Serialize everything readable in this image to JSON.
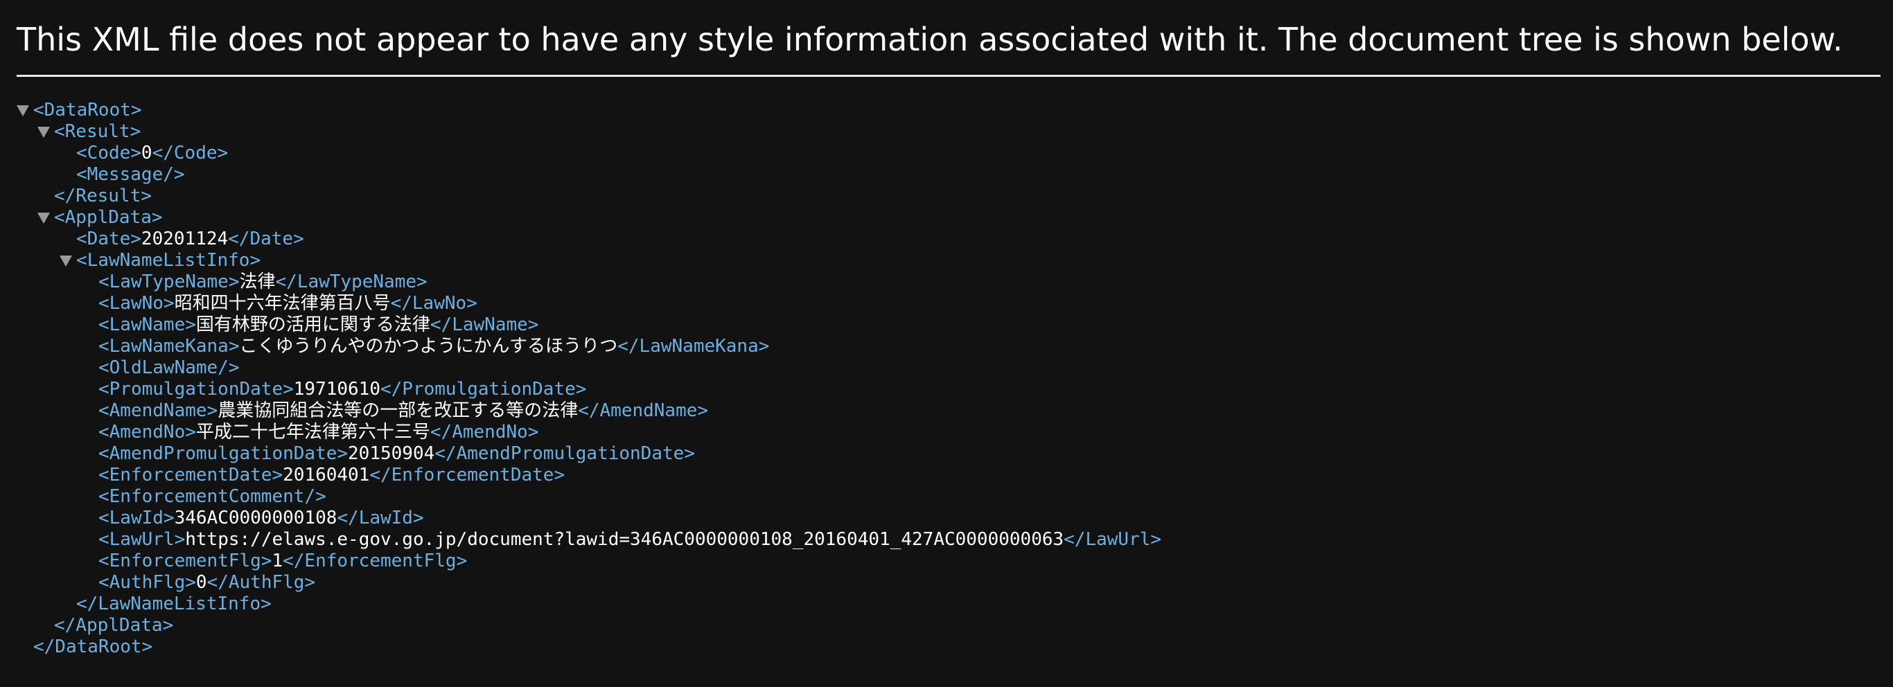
{
  "notice": "This XML file does not appear to have any style information associated with it. The document tree is shown below.",
  "tree": {
    "dataroot_open": "<DataRoot>",
    "result_open": "<Result>",
    "code_open": "<Code>",
    "code_value": "0",
    "code_close": "</Code>",
    "message_empty": "<Message/>",
    "result_close": "</Result>",
    "appldata_open": "<ApplData>",
    "date_open": "<Date>",
    "date_value": "20201124",
    "date_close": "</Date>",
    "lawnamelistinfo_open": "<LawNameListInfo>",
    "lawtypename_open": "<LawTypeName>",
    "lawtypename_value": "法律",
    "lawtypename_close": "</LawTypeName>",
    "lawno_open": "<LawNo>",
    "lawno_value": "昭和四十六年法律第百八号",
    "lawno_close": "</LawNo>",
    "lawname_open": "<LawName>",
    "lawname_value": "国有林野の活用に関する法律",
    "lawname_close": "</LawName>",
    "lawnamekana_open": "<LawNameKana>",
    "lawnamekana_value": "こくゆうりんやのかつようにかんするほうりつ",
    "lawnamekana_close": "</LawNameKana>",
    "oldlawname_empty": "<OldLawName/>",
    "promulgationdate_open": "<PromulgationDate>",
    "promulgationdate_value": "19710610",
    "promulgationdate_close": "</PromulgationDate>",
    "amendname_open": "<AmendName>",
    "amendname_value": "農業協同組合法等の一部を改正する等の法律",
    "amendname_close": "</AmendName>",
    "amendno_open": "<AmendNo>",
    "amendno_value": "平成二十七年法律第六十三号",
    "amendno_close": "</AmendNo>",
    "amendpromulgationdate_open": "<AmendPromulgationDate>",
    "amendpromulgationdate_value": "20150904",
    "amendpromulgationdate_close": "</AmendPromulgationDate>",
    "enforcementdate_open": "<EnforcementDate>",
    "enforcementdate_value": "20160401",
    "enforcementdate_close": "</EnforcementDate>",
    "enforcementcomment_empty": "<EnforcementComment/>",
    "lawid_open": "<LawId>",
    "lawid_value": "346AC0000000108",
    "lawid_close": "</LawId>",
    "lawurl_open": "<LawUrl>",
    "lawurl_value": "https://elaws.e-gov.go.jp/document?lawid=346AC0000000108_20160401_427AC0000000063",
    "lawurl_close": "</LawUrl>",
    "enforcementflg_open": "<EnforcementFlg>",
    "enforcementflg_value": "1",
    "enforcementflg_close": "</EnforcementFlg>",
    "authflg_open": "<AuthFlg>",
    "authflg_value": "0",
    "authflg_close": "</AuthFlg>",
    "lawnamelistinfo_close": "</LawNameListInfo>",
    "appldata_close": "</ApplData>",
    "dataroot_close": "</DataRoot>"
  },
  "colors": {
    "background": "#121212",
    "tag": "#6ab0e3",
    "text": "#ffffff",
    "toggle": "#9a9a9a"
  }
}
